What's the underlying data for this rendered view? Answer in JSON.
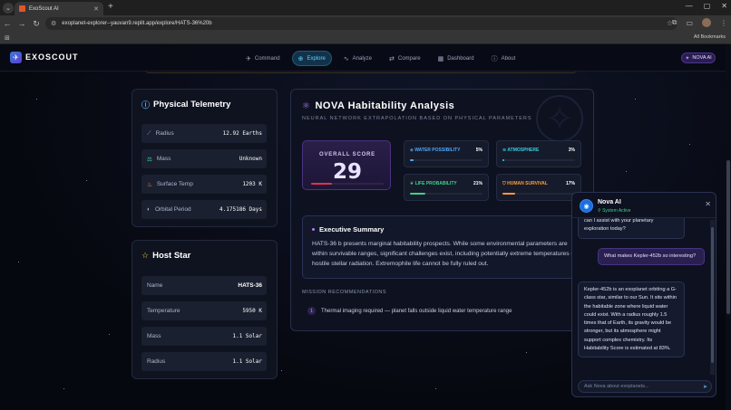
{
  "browser": {
    "tab_title": "ExoScout AI",
    "tab_close": "✕",
    "new_tab": "+",
    "url": "exoplanet-explorer--yauvan9.replit.app/explore/HATS-36%20b",
    "all_bookmarks": "All Bookmarks",
    "window_controls": [
      "—",
      "▢",
      "✕"
    ]
  },
  "app": {
    "logo": "EXOSCOUT",
    "nav": [
      {
        "icon": "rocket-icon",
        "glyph": "✈",
        "label": "Command"
      },
      {
        "icon": "globe-icon",
        "glyph": "⊕",
        "label": "Explore"
      },
      {
        "icon": "activity-icon",
        "glyph": "∿",
        "label": "Analyze"
      },
      {
        "icon": "compare-icon",
        "glyph": "⇄",
        "label": "Compare"
      },
      {
        "icon": "dashboard-icon",
        "glyph": "▦",
        "label": "Dashboard"
      },
      {
        "icon": "info-icon",
        "glyph": "ⓘ",
        "label": "About"
      }
    ],
    "nova_button": "NOVA AI"
  },
  "telemetry": {
    "title": "Physical Telemetry",
    "rows": [
      {
        "label": "Radius",
        "value": "12.92 Earths",
        "icon": "ruler-icon",
        "glyph": "⟋",
        "color": "#4fa8ff"
      },
      {
        "label": "Mass",
        "value": "Unknown",
        "icon": "scale-icon",
        "glyph": "⚖",
        "color": "#3fd18a"
      },
      {
        "label": "Surface Temp",
        "value": "1203 K",
        "icon": "thermometer-icon",
        "glyph": "🌡",
        "color": "#ff9a3c"
      },
      {
        "label": "Orbital Period",
        "value": "4.175186 Days",
        "icon": "orbit-icon",
        "glyph": "◐",
        "color": "#aab"
      }
    ]
  },
  "host_star": {
    "title": "Host Star",
    "rows": [
      {
        "label": "Name",
        "value": "HATS-36"
      },
      {
        "label": "Temperature",
        "value": "5950 K"
      },
      {
        "label": "Mass",
        "value": "1.1 Solar"
      },
      {
        "label": "Radius",
        "value": "1.1 Solar"
      }
    ]
  },
  "nova_analysis": {
    "title": "NOVA Habitability Analysis",
    "subtitle": "NEURAL NETWORK EXTRAPOLATION BASED ON PHYSICAL PARAMETERS",
    "overall_label": "OVERALL SCORE",
    "overall_score": "29",
    "overall_fraction": 0.29,
    "metrics": [
      {
        "label": "WATER POSSIBILITY",
        "pct": "5%",
        "value": 0.05,
        "color": "#4fa8ff",
        "icon": "droplet-icon",
        "glyph": "💧"
      },
      {
        "label": "ATMOSPHERE",
        "pct": "3%",
        "value": 0.03,
        "color": "#37d0e0",
        "icon": "wind-icon",
        "glyph": "≋"
      },
      {
        "label": "LIFE PROBABILITY",
        "pct": "21%",
        "value": 0.21,
        "color": "#3fd18a",
        "icon": "leaf-icon",
        "glyph": "❦"
      },
      {
        "label": "HUMAN SURVIVAL",
        "pct": "17%",
        "value": 0.17,
        "color": "#ff9a3c",
        "icon": "shield-icon",
        "glyph": "⛉"
      }
    ],
    "exec_title": "Executive Summary",
    "exec_text": "HATS-36 b presents marginal habitability prospects. While some environmental parameters are within survivable ranges, significant challenges exist, including potentially extreme temperatures or hostile stellar radiation. Extremophile life cannot be fully ruled out.",
    "mission_header": "MISSION RECOMMENDATIONS",
    "missions": [
      {
        "num": "1",
        "text": "Thermal imaging required — planet falls outside liquid water temperature range"
      }
    ]
  },
  "chat": {
    "name": "Nova AI",
    "status": "System Active",
    "messages": [
      {
        "role": "ai",
        "text": "can I assist with your planetary exploration today?"
      },
      {
        "role": "user",
        "text": "What makes Kepler-452b so interesting?"
      },
      {
        "role": "ai",
        "text": "Kepler-452b is an exoplanet orbiting a G-class star, similar to our Sun. It sits within the habitable zone where liquid water could exist. With a radius roughly 1.5 times that of Earth, its gravity would be stronger, but its atmosphere might support complex chemistry. Its Habitability Score is estimated at 83%."
      }
    ],
    "input_placeholder": "Ask Nova about exoplanets..."
  }
}
